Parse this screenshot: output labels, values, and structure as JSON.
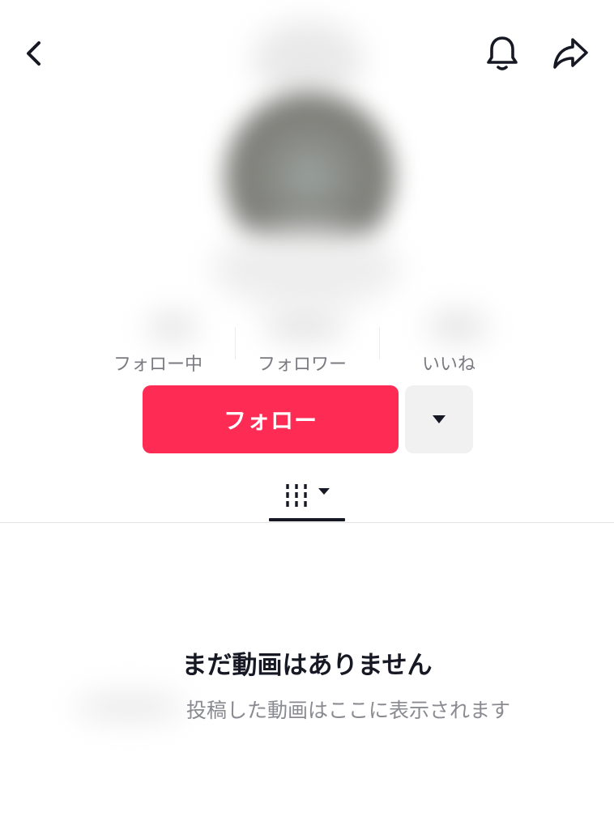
{
  "header": {
    "back_icon": "chevron-left-icon",
    "bell_icon": "bell-icon",
    "share_icon": "share-arrow-icon"
  },
  "profile": {
    "stats": [
      {
        "label": "フォロー中"
      },
      {
        "label": "フォロワー"
      },
      {
        "label": "いいね"
      }
    ],
    "follow_label": "フォロー",
    "more_icon": "caret-down-icon"
  },
  "tabs": {
    "videos_icon": "grid-columns-icon",
    "videos_caret_icon": "caret-down-icon"
  },
  "empty_state": {
    "title": "まだ動画はありません",
    "subtitle": "投稿した動画はここに表示されます"
  },
  "colors": {
    "accent": "#fe2c55",
    "text": "#161823",
    "muted": "#8a8b91",
    "secondary_button": "#f1f1f2"
  }
}
